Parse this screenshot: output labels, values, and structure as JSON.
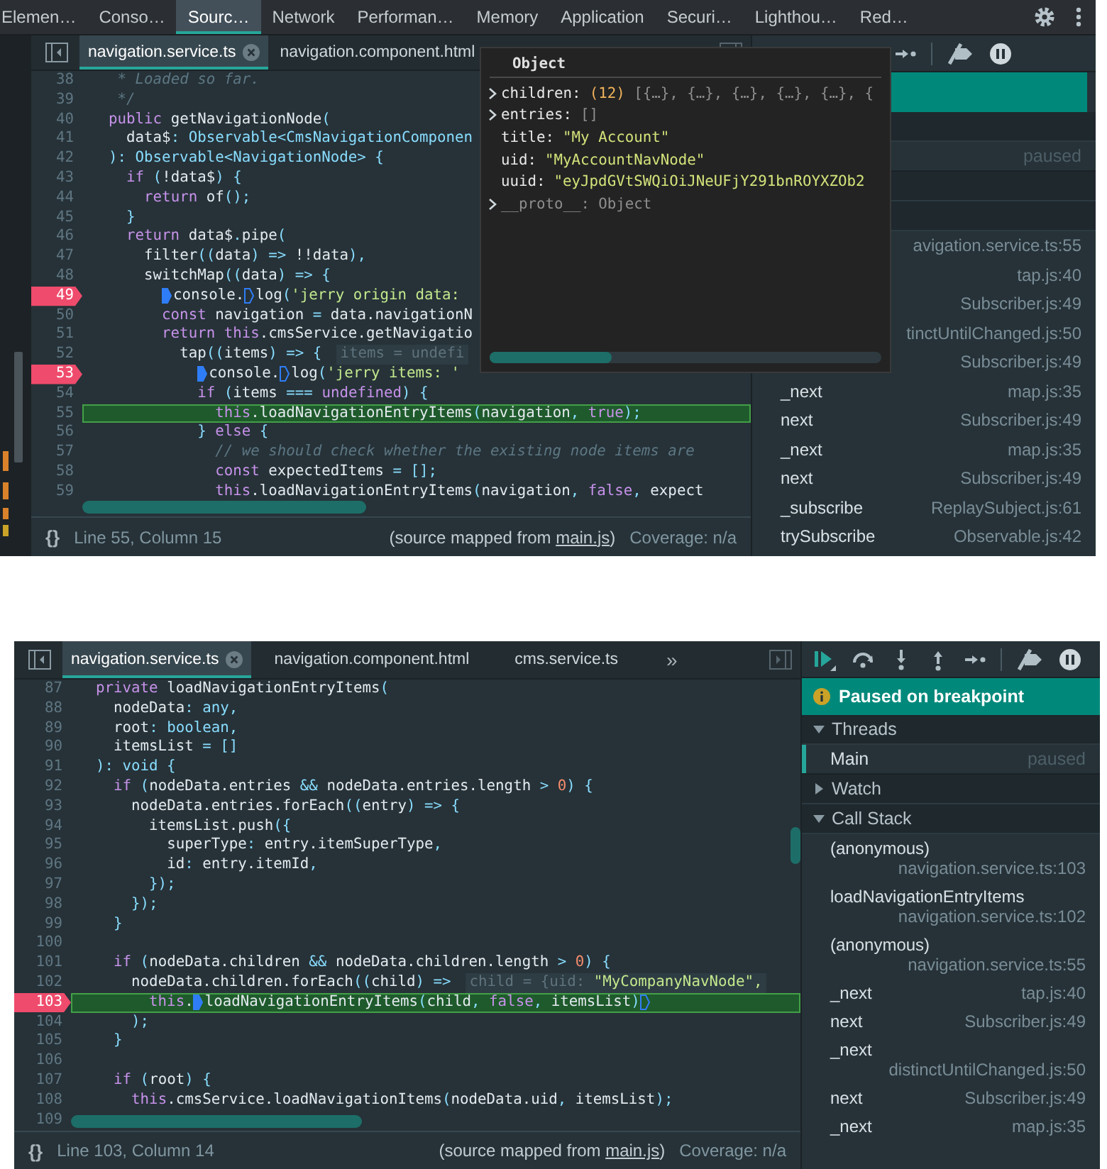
{
  "panels": [
    {
      "devtools_tabs": [
        {
          "label": "Elemen…",
          "selected": false
        },
        {
          "label": "Conso…",
          "selected": false
        },
        {
          "label": "Sourc…",
          "selected": true
        },
        {
          "label": "Network",
          "selected": false
        },
        {
          "label": "Performan…",
          "selected": false
        },
        {
          "label": "Memory",
          "selected": false
        },
        {
          "label": "Application",
          "selected": false
        },
        {
          "label": "Securi…",
          "selected": false
        },
        {
          "label": "Lighthou…",
          "selected": false
        },
        {
          "label": "Red…",
          "selected": false
        }
      ],
      "file_tabs": [
        {
          "label": "navigation.service.ts",
          "selected": true,
          "closable": true
        },
        {
          "label": "navigation.component.html",
          "selected": false,
          "closable": false
        }
      ],
      "lines": [
        {
          "number": "38",
          "breakpoint": false,
          "current": false,
          "tokens": [
            {
              "kind": "cmt",
              "t": "   * Loaded so far."
            }
          ]
        },
        {
          "number": "39",
          "breakpoint": false,
          "current": false,
          "tokens": [
            {
              "kind": "cmt",
              "t": "   */"
            }
          ]
        },
        {
          "number": "40",
          "breakpoint": false,
          "current": false,
          "tokens": [
            {
              "kind": "kw",
              "t": "  public"
            },
            {
              "kind": "p",
              "t": " getNavigationNode"
            },
            {
              "kind": "ty",
              "t": "("
            }
          ]
        },
        {
          "number": "41",
          "breakpoint": false,
          "current": false,
          "tokens": [
            {
              "kind": "p",
              "t": "    data$"
            },
            {
              "kind": "ty",
              "t": ": Observable<CmsNavigationComponen"
            }
          ]
        },
        {
          "number": "42",
          "breakpoint": false,
          "current": false,
          "tokens": [
            {
              "kind": "ty",
              "t": "  ): Observable<NavigationNode> {"
            }
          ]
        },
        {
          "number": "43",
          "breakpoint": false,
          "current": false,
          "tokens": [
            {
              "kind": "kw",
              "t": "    if"
            },
            {
              "kind": "ty",
              "t": " ("
            },
            {
              "kind": "p",
              "t": "!data$"
            },
            {
              "kind": "ty",
              "t": ") {"
            }
          ]
        },
        {
          "number": "44",
          "breakpoint": false,
          "current": false,
          "tokens": [
            {
              "kind": "kw",
              "t": "      return"
            },
            {
              "kind": "p",
              "t": " of"
            },
            {
              "kind": "ty",
              "t": "();"
            }
          ]
        },
        {
          "number": "45",
          "breakpoint": false,
          "current": false,
          "tokens": [
            {
              "kind": "ty",
              "t": "    }"
            }
          ]
        },
        {
          "number": "46",
          "breakpoint": false,
          "current": false,
          "tokens": [
            {
              "kind": "kw",
              "t": "    return"
            },
            {
              "kind": "p",
              "t": " data$"
            },
            {
              "kind": "ty",
              "t": "."
            },
            {
              "kind": "p",
              "t": "pipe"
            },
            {
              "kind": "ty",
              "t": "("
            }
          ]
        },
        {
          "number": "47",
          "breakpoint": false,
          "current": false,
          "tokens": [
            {
              "kind": "p",
              "t": "      filter"
            },
            {
              "kind": "ty",
              "t": "(("
            },
            {
              "kind": "p",
              "t": "data"
            },
            {
              "kind": "ty",
              "t": ") => "
            },
            {
              "kind": "p",
              "t": "!!data"
            },
            {
              "kind": "ty",
              "t": "),"
            }
          ]
        },
        {
          "number": "48",
          "breakpoint": false,
          "current": false,
          "tokens": [
            {
              "kind": "p",
              "t": "      switchMap"
            },
            {
              "kind": "ty",
              "t": "(("
            },
            {
              "kind": "p",
              "t": "data"
            },
            {
              "kind": "ty",
              "t": ") => {"
            }
          ]
        },
        {
          "number": "49",
          "breakpoint": true,
          "current": false,
          "tokens": [
            {
              "kind": "p",
              "t": "        console.",
              "marker": true
            },
            {
              "kind": "p",
              "t": "log",
              "marker": false
            },
            {
              "kind": "ty",
              "t": "("
            },
            {
              "kind": "str",
              "t": "'jerry origin data:"
            }
          ]
        },
        {
          "number": "50",
          "breakpoint": false,
          "current": false,
          "tokens": [
            {
              "kind": "kw",
              "t": "        const"
            },
            {
              "kind": "p",
              "t": " navigation "
            },
            {
              "kind": "ty",
              "t": "="
            },
            {
              "kind": "p",
              "t": " data.navigationN"
            }
          ]
        },
        {
          "number": "51",
          "breakpoint": false,
          "current": false,
          "tokens": [
            {
              "kind": "kw",
              "t": "        return this"
            },
            {
              "kind": "p",
              "t": ".cmsService.getNavigatio"
            }
          ]
        },
        {
          "number": "52",
          "breakpoint": false,
          "current": false,
          "tokens": [
            {
              "kind": "p",
              "t": "          tap"
            },
            {
              "kind": "ty",
              "t": "(("
            },
            {
              "kind": "p",
              "t": "items"
            },
            {
              "kind": "ty",
              "t": ") => {"
            },
            {
              "kind": "hint",
              "t": "items = undefi"
            }
          ]
        },
        {
          "number": "53",
          "breakpoint": true,
          "current": false,
          "tokens": [
            {
              "kind": "p",
              "t": "            console.",
              "marker": true
            },
            {
              "kind": "p",
              "t": "log",
              "marker": false
            },
            {
              "kind": "ty",
              "t": "("
            },
            {
              "kind": "str",
              "t": "'jerry items: '"
            }
          ]
        },
        {
          "number": "54",
          "breakpoint": false,
          "current": false,
          "tokens": [
            {
              "kind": "kw",
              "t": "            if"
            },
            {
              "kind": "ty",
              "t": " ("
            },
            {
              "kind": "p",
              "t": "items "
            },
            {
              "kind": "ty",
              "t": "==="
            },
            {
              "kind": "kw",
              "t": " undefined"
            },
            {
              "kind": "ty",
              "t": ") {"
            }
          ]
        },
        {
          "number": "55",
          "breakpoint": false,
          "current": true,
          "tokens": [
            {
              "kind": "kw",
              "t": "              this"
            },
            {
              "kind": "p",
              "t": ".loadNavigationEntryItems"
            },
            {
              "kind": "ty",
              "t": "("
            },
            {
              "kind": "p",
              "t": "navigation"
            },
            {
              "kind": "ty",
              "t": ", "
            },
            {
              "kind": "kw",
              "t": "true"
            },
            {
              "kind": "ty",
              "t": ");"
            }
          ]
        },
        {
          "number": "56",
          "breakpoint": false,
          "current": false,
          "tokens": [
            {
              "kind": "ty",
              "t": "            } "
            },
            {
              "kind": "kw",
              "t": "else"
            },
            {
              "kind": "ty",
              "t": " {"
            }
          ]
        },
        {
          "number": "57",
          "breakpoint": false,
          "current": false,
          "tokens": [
            {
              "kind": "cmt",
              "t": "              // we should check whether the existing node items are"
            }
          ]
        },
        {
          "number": "58",
          "breakpoint": false,
          "current": false,
          "tokens": [
            {
              "kind": "kw",
              "t": "              const"
            },
            {
              "kind": "p",
              "t": " expectedItems "
            },
            {
              "kind": "ty",
              "t": "= [];"
            }
          ]
        },
        {
          "number": "59",
          "breakpoint": false,
          "current": false,
          "tokens": [
            {
              "kind": "kw",
              "t": "              this"
            },
            {
              "kind": "p",
              "t": ".loadNavigationEntryItems"
            },
            {
              "kind": "ty",
              "t": "("
            },
            {
              "kind": "p",
              "t": "navigation"
            },
            {
              "kind": "ty",
              "t": ", "
            },
            {
              "kind": "kw",
              "t": "false"
            },
            {
              "kind": "ty",
              "t": ", "
            },
            {
              "kind": "p",
              "t": "expect"
            }
          ]
        }
      ],
      "status": {
        "format": "{}",
        "position": "Line 55, Column 15",
        "source_map": {
          "before": "(source mapped from ",
          "link": "main.js",
          "after": ")"
        },
        "coverage": "Coverage: n/a"
      },
      "debugger": {
        "toolbar": [
          {
            "kind": "step"
          },
          {
            "kind": "deactivate"
          },
          {
            "kind": "pause"
          }
        ],
        "banner": {
          "kind": "paused"
        },
        "sections": [
          {
            "kind": "header"
          },
          {
            "kind": "thread",
            "status": "paused"
          },
          {
            "kind": "header"
          },
          {
            "kind": "header"
          }
        ],
        "frames": [
          {
            "file": "avigation.service.ts:55"
          },
          {
            "file": "tap.js:40"
          },
          {
            "file": "Subscriber.js:49"
          },
          {
            "file": "tinctUntilChanged.js:50"
          },
          {
            "file": "Subscriber.js:49"
          },
          {
            "name": "_next",
            "file": "map.js:35"
          },
          {
            "name": "next",
            "file": "Subscriber.js:49"
          },
          {
            "name": "_next",
            "file": "map.js:35"
          },
          {
            "name": "next",
            "file": "Subscriber.js:49"
          },
          {
            "name": "_subscribe",
            "file": "ReplaySubject.js:61"
          },
          {
            "name": "trySubscribe",
            "file": "Observable.js:42"
          }
        ]
      },
      "popover": {
        "title": "Object",
        "properties": [
          {
            "key": "children:",
            "count": "(12)",
            "value": "[{…}, {…}, {…}, {…}, {…}, {",
            "kind": "array",
            "expandable": true
          },
          {
            "key": "entries:",
            "value": "[]",
            "kind": "array",
            "expandable": true
          },
          {
            "key": "title:",
            "value": "\"My Account\"",
            "kind": "string",
            "expandable": false
          },
          {
            "key": "uid:",
            "value": "\"MyAccountNavNode\"",
            "kind": "string",
            "expandable": false
          },
          {
            "key": "uuid:",
            "value": "\"eyJpdGVtSWQiOiJNeUFjY291bnROYXZOb2",
            "kind": "string",
            "expandable": false
          },
          {
            "key": "__proto__:",
            "value": "Object",
            "kind": "object",
            "expandable": true
          }
        ]
      }
    },
    {
      "file_tabs": [
        {
          "label": "navigation.service.ts",
          "selected": true,
          "closable": true
        },
        {
          "label": "navigation.component.html",
          "selected": false,
          "closable": false
        },
        {
          "label": "cms.service.ts",
          "selected": false,
          "closable": false
        }
      ],
      "more": "»",
      "lines": [
        {
          "number": "87",
          "breakpoint": false,
          "current": false,
          "tokens": [
            {
              "kind": "kw",
              "t": "  private"
            },
            {
              "kind": "p",
              "t": " loadNavigationEntryItems"
            },
            {
              "kind": "ty",
              "t": "("
            }
          ]
        },
        {
          "number": "88",
          "breakpoint": false,
          "current": false,
          "tokens": [
            {
              "kind": "p",
              "t": "    nodeData"
            },
            {
              "kind": "ty",
              "t": ": any,"
            }
          ]
        },
        {
          "number": "89",
          "breakpoint": false,
          "current": false,
          "tokens": [
            {
              "kind": "p",
              "t": "    root"
            },
            {
              "kind": "ty",
              "t": ": boolean,"
            }
          ]
        },
        {
          "number": "90",
          "breakpoint": false,
          "current": false,
          "tokens": [
            {
              "kind": "p",
              "t": "    itemsList "
            },
            {
              "kind": "ty",
              "t": "= []"
            }
          ]
        },
        {
          "number": "91",
          "breakpoint": false,
          "current": false,
          "tokens": [
            {
              "kind": "ty",
              "t": "  ): void {"
            }
          ]
        },
        {
          "number": "92",
          "breakpoint": false,
          "current": false,
          "tokens": [
            {
              "kind": "kw",
              "t": "    if"
            },
            {
              "kind": "ty",
              "t": " ("
            },
            {
              "kind": "p",
              "t": "nodeData.entries "
            },
            {
              "kind": "ty",
              "t": "&&"
            },
            {
              "kind": "p",
              "t": " nodeData.entries.length "
            },
            {
              "kind": "ty",
              "t": ">"
            },
            {
              "kind": "num",
              "t": " 0"
            },
            {
              "kind": "ty",
              "t": ") {"
            }
          ]
        },
        {
          "number": "93",
          "breakpoint": false,
          "current": false,
          "tokens": [
            {
              "kind": "p",
              "t": "      nodeData.entries.forEach"
            },
            {
              "kind": "ty",
              "t": "(("
            },
            {
              "kind": "p",
              "t": "entry"
            },
            {
              "kind": "ty",
              "t": ") => {"
            }
          ]
        },
        {
          "number": "94",
          "breakpoint": false,
          "current": false,
          "tokens": [
            {
              "kind": "p",
              "t": "        itemsList.push"
            },
            {
              "kind": "ty",
              "t": "({"
            }
          ]
        },
        {
          "number": "95",
          "breakpoint": false,
          "current": false,
          "tokens": [
            {
              "kind": "p",
              "t": "          superType"
            },
            {
              "kind": "ty",
              "t": ": "
            },
            {
              "kind": "p",
              "t": "entry.itemSuperType"
            },
            {
              "kind": "ty",
              "t": ","
            }
          ]
        },
        {
          "number": "96",
          "breakpoint": false,
          "current": false,
          "tokens": [
            {
              "kind": "p",
              "t": "          id"
            },
            {
              "kind": "ty",
              "t": ": "
            },
            {
              "kind": "p",
              "t": "entry.itemId"
            },
            {
              "kind": "ty",
              "t": ","
            }
          ]
        },
        {
          "number": "97",
          "breakpoint": false,
          "current": false,
          "tokens": [
            {
              "kind": "ty",
              "t": "        });"
            }
          ]
        },
        {
          "number": "98",
          "breakpoint": false,
          "current": false,
          "tokens": [
            {
              "kind": "ty",
              "t": "      });"
            }
          ]
        },
        {
          "number": "99",
          "breakpoint": false,
          "current": false,
          "tokens": [
            {
              "kind": "ty",
              "t": "    }"
            }
          ]
        },
        {
          "number": "100",
          "breakpoint": false,
          "current": false
        },
        {
          "number": "101",
          "breakpoint": false,
          "current": false,
          "tokens": [
            {
              "kind": "kw",
              "t": "    if"
            },
            {
              "kind": "ty",
              "t": " ("
            },
            {
              "kind": "p",
              "t": "nodeData.children "
            },
            {
              "kind": "ty",
              "t": "&&"
            },
            {
              "kind": "p",
              "t": " nodeData.children.length "
            },
            {
              "kind": "ty",
              "t": ">"
            },
            {
              "kind": "num",
              "t": " 0"
            },
            {
              "kind": "ty",
              "t": ") {"
            }
          ]
        },
        {
          "number": "102",
          "breakpoint": false,
          "current": false,
          "tokens": [
            {
              "kind": "p",
              "t": "      nodeData.children.forEach"
            },
            {
              "kind": "ty",
              "t": "(("
            },
            {
              "kind": "p",
              "t": "child"
            },
            {
              "kind": "ty",
              "t": ") =>"
            },
            {
              "kind": "hint",
              "t": "child = {uid: "
            },
            {
              "kind": "hstr",
              "t": "\"MyCompanyNavNode\","
            }
          ]
        },
        {
          "number": "103",
          "breakpoint": true,
          "current": true,
          "tokens": [
            {
              "kind": "kw",
              "t": "        this"
            },
            {
              "kind": "p",
              "t": "."
            },
            {
              "kind": "p",
              "t": "loadNavigationEntryItems",
              "marker": true
            },
            {
              "kind": "ty",
              "t": "("
            },
            {
              "kind": "p",
              "t": "child"
            },
            {
              "kind": "ty",
              "t": ", "
            },
            {
              "kind": "kw",
              "t": "false"
            },
            {
              "kind": "ty",
              "t": ", "
            },
            {
              "kind": "p",
              "t": "itemsList"
            },
            {
              "kind": "ty",
              "t": ")",
              "end_marker": false
            }
          ]
        },
        {
          "number": "104",
          "breakpoint": false,
          "current": false,
          "tokens": [
            {
              "kind": "ty",
              "t": "      );"
            }
          ]
        },
        {
          "number": "105",
          "breakpoint": false,
          "current": false,
          "tokens": [
            {
              "kind": "ty",
              "t": "    }"
            }
          ]
        },
        {
          "number": "106",
          "breakpoint": false,
          "current": false
        },
        {
          "number": "107",
          "breakpoint": false,
          "current": false,
          "tokens": [
            {
              "kind": "kw",
              "t": "    if"
            },
            {
              "kind": "ty",
              "t": " ("
            },
            {
              "kind": "p",
              "t": "root"
            },
            {
              "kind": "ty",
              "t": ") {"
            }
          ]
        },
        {
          "number": "108",
          "breakpoint": false,
          "current": false,
          "tokens": [
            {
              "kind": "kw",
              "t": "      this"
            },
            {
              "kind": "p",
              "t": ".cmsService.loadNavigationItems"
            },
            {
              "kind": "ty",
              "t": "("
            },
            {
              "kind": "p",
              "t": "nodeData.uid"
            },
            {
              "kind": "ty",
              "t": ", "
            },
            {
              "kind": "p",
              "t": "itemsList"
            },
            {
              "kind": "ty",
              "t": ");"
            }
          ]
        },
        {
          "number": "109",
          "breakpoint": false,
          "current": false
        }
      ],
      "status": {
        "format": "{}",
        "position": "Line 103, Column 14",
        "source_map": {
          "before": "(source mapped from ",
          "link": "main.js",
          "after": ")"
        },
        "coverage": "Coverage: n/a"
      },
      "debugger": {
        "toolbar": [
          {
            "kind": "resume"
          },
          {
            "kind": "step-over"
          },
          {
            "kind": "step-into"
          },
          {
            "kind": "step-out"
          },
          {
            "kind": "step"
          },
          {
            "kind": "deactivate"
          },
          {
            "kind": "pause"
          }
        ],
        "banner": {
          "kind": "paused",
          "text": "Paused on breakpoint"
        },
        "sections": [
          {
            "kind": "header",
            "label": "Threads",
            "expanded": true
          },
          {
            "kind": "thread",
            "name": "Main",
            "status": "paused",
            "selected": true
          },
          {
            "kind": "header",
            "label": "Watch",
            "expanded": false
          },
          {
            "kind": "header",
            "label": "Call Stack",
            "expanded": true
          }
        ],
        "frames": [
          {
            "name": "(anonymous)",
            "file": "navigation.service.ts:103"
          },
          {
            "name": "loadNavigationEntryItems",
            "file": "navigation.service.ts:102"
          },
          {
            "name": "(anonymous)",
            "file": "navigation.service.ts:55"
          },
          {
            "name": "_next",
            "file": "tap.js:40"
          },
          {
            "name": "next",
            "file": "Subscriber.js:49"
          },
          {
            "name": "_next",
            "file": "distinctUntilChanged.js:50"
          },
          {
            "name": "next",
            "file": "Subscriber.js:49"
          },
          {
            "name": "_next",
            "file": "map.js:35"
          }
        ]
      }
    }
  ]
}
